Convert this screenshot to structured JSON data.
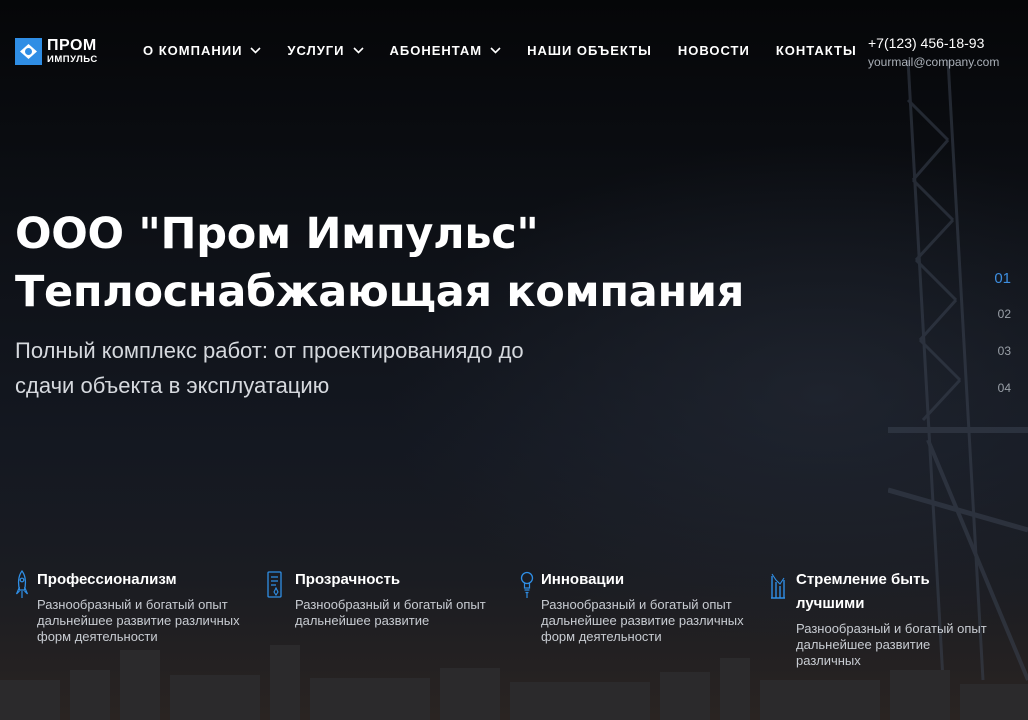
{
  "logo": {
    "line1": "ПРОМ",
    "line2": "ИМПУЛЬС",
    "accent": "#2f8ee5"
  },
  "nav": {
    "items": [
      {
        "label": "О КОМПАНИИ",
        "dropdown": true
      },
      {
        "label": "УСЛУГИ",
        "dropdown": true
      },
      {
        "label": "АБОНЕНТАМ",
        "dropdown": true
      },
      {
        "label": "НАШИ ОБЪЕКТЫ",
        "dropdown": false
      },
      {
        "label": "НОВОСТИ",
        "dropdown": false
      },
      {
        "label": "КОНТАКТЫ",
        "dropdown": false
      }
    ]
  },
  "contacts": {
    "phone": "+7(123) 456-18-93",
    "email": "yourmail@company.com"
  },
  "hero": {
    "title_line1": "ООО \"Пром Импульс\"",
    "title_line2": "Теплоснабжающая компания",
    "subtitle_line1": "Полный комплекс работ: от проектированиядо до",
    "subtitle_line2": "сдачи объекта в эксплуатацию"
  },
  "slider": {
    "pages": [
      "01",
      "02",
      "03",
      "04"
    ],
    "active_index": 0,
    "active_color": "#3d8ee0"
  },
  "features": [
    {
      "icon": "rocket-icon",
      "title": "Профессионализм",
      "title_line2": "",
      "text_lines": [
        "Разнообразный и богатый опыт",
        "дальнейшее развитие различных",
        "форм деятельности"
      ]
    },
    {
      "icon": "document-icon",
      "title": "Прозрачность",
      "title_line2": "",
      "text_lines": [
        "Разнообразный и богатый опыт",
        "дальнейшее развитие",
        ""
      ]
    },
    {
      "icon": "bulb-icon",
      "title": "Инновации",
      "title_line2": "",
      "text_lines": [
        "Разнообразный и богатый опыт",
        "дальнейшее развитие различных",
        "форм деятельности"
      ]
    },
    {
      "icon": "chart-icon",
      "title": "Стремление быть",
      "title_line2": "лучшими",
      "text_lines": [
        "Разнообразный и богатый опыт",
        "дальнейшее развитие",
        "различных"
      ]
    }
  ]
}
